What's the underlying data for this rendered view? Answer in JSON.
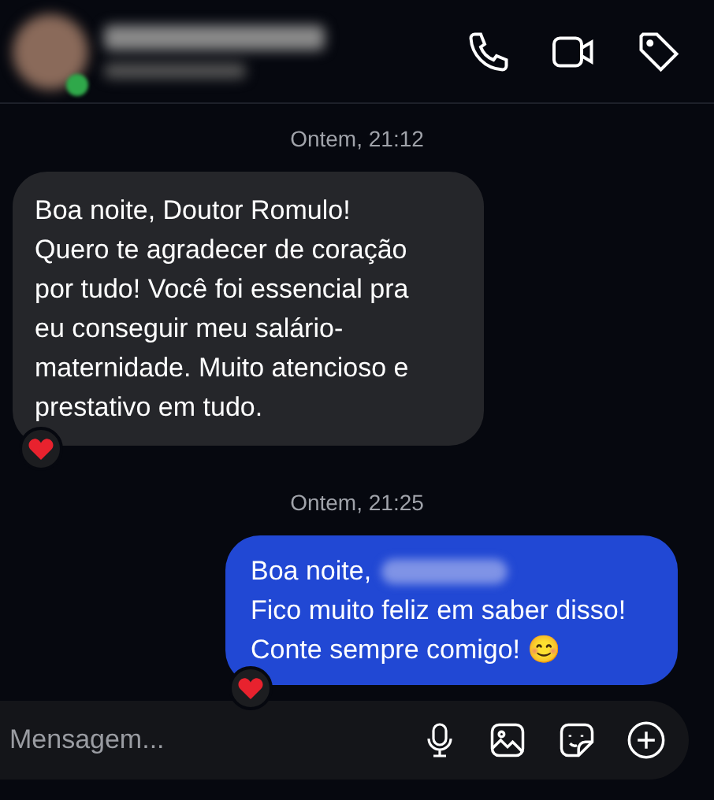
{
  "header": {
    "online": true,
    "actions": [
      {
        "kind": "phone"
      },
      {
        "kind": "video"
      },
      {
        "kind": "tag"
      }
    ]
  },
  "messages": [
    {
      "kind": "time",
      "text": "Ontem, 21:12"
    },
    {
      "kind": "incoming",
      "lines": [
        "Boa noite, Doutor Romulo!",
        "Quero te agradecer de coração",
        "por tudo! Você foi essencial pra",
        "eu conseguir meu salário-",
        "maternidade. Muito atencioso e",
        "prestativo em tudo."
      ],
      "reacted": true
    },
    {
      "kind": "time",
      "text": "Ontem, 21:25"
    },
    {
      "kind": "outgoing",
      "lines": [
        "Boa noite,",
        "Fico muito feliz em saber disso!",
        "Conte sempre comigo! 😊"
      ],
      "redacted_after_first": true,
      "reacted": true
    }
  ],
  "composer": {
    "placeholder": "Mensagem..."
  }
}
